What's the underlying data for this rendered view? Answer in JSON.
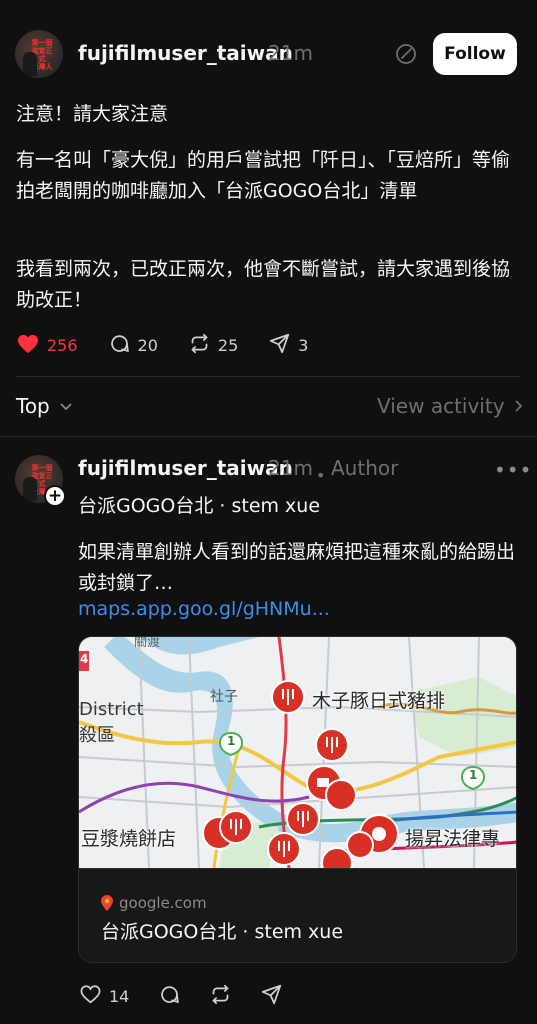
{
  "post": {
    "username": "fujifilmuser_taiwan",
    "time": "21m",
    "follow_label": "Follow",
    "avatar_text": "第一個\n盗宣正式\n台灣人",
    "paragraphs": [
      "注意！請大家注意",
      "有一名叫「豪大倪」的用戶嘗試把「阡日」、「豆焙所」等偷拍老闆開的咖啡廳加入「台派GOGO台北」清單",
      "我看到兩次，已改正兩次，他會不斷嘗試，請大家遇到後協助改正！"
    ],
    "likes": "256",
    "replies": "20",
    "reposts": "25",
    "shares": "3"
  },
  "sort": {
    "label": "Top",
    "activity_label": "View activity"
  },
  "reply": {
    "username": "fujifilmuser_taiwan",
    "time": "21m",
    "separator": "•",
    "author_label": "Author",
    "more_label": "•••",
    "subtitle": "台派GOGO台北 · stem xue",
    "text": "如果清單創辦人看到的話還麻煩把這種來亂的給踢出或封鎖了…",
    "link": "maps.app.goo.gl/gHNMu...",
    "card": {
      "domain": "google.com",
      "title": "台派GOGO台北 · stem xue",
      "map_labels": {
        "district": "District",
        "district_2": "殺區",
        "shezi": "社子",
        "restaurant_1": "木子豚日式豬排",
        "restaurant_2": "豆漿燒餅店",
        "law_firm": "揚昇法律專",
        "route_1": "1",
        "route_2": "1",
        "route_3": "4",
        "top_label": "關渡"
      }
    },
    "likes": "14"
  },
  "colors": {
    "background": "#101010",
    "text": "#f3f5f7",
    "muted": "#6f6f6f",
    "like_red": "#ff3040",
    "link_blue": "#3a8fe8",
    "pin_red": "#d93025"
  },
  "icons": [
    "heart-icon",
    "comment-icon",
    "repost-icon",
    "share-icon",
    "edit-icon",
    "chevron-down-icon",
    "chevron-right-icon",
    "plus-icon",
    "google-maps-pin-icon",
    "fork-knife-icon",
    "coffee-icon"
  ]
}
